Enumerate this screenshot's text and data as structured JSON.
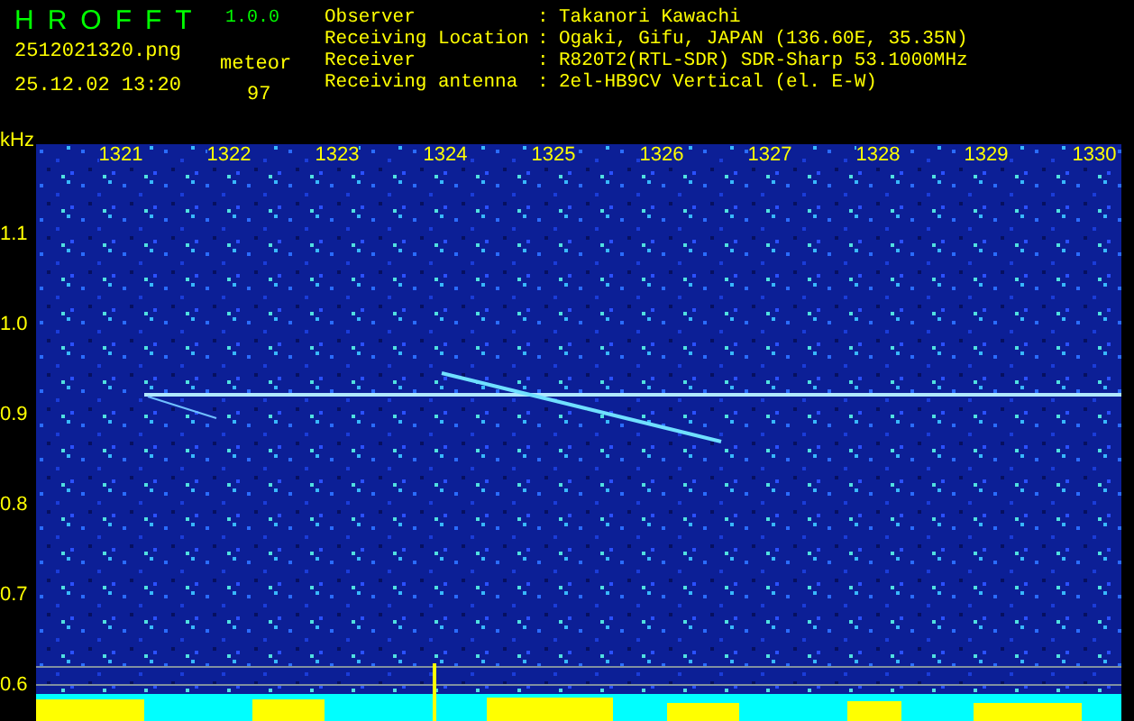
{
  "app": {
    "title": "HROFFT",
    "version": "1.0.0"
  },
  "file": {
    "name": "2512021320.png",
    "datetime": "25.12.02 13:20",
    "count_label": "meteor",
    "count": "97"
  },
  "info": [
    {
      "label": "Observer",
      "separator": ":",
      "value": "Takanori Kawachi"
    },
    {
      "label": "Receiving Location",
      "separator": ":",
      "value": "Ogaki, Gifu, JAPAN (136.60E, 35.35N)"
    },
    {
      "label": "Receiver",
      "separator": ":",
      "value": "R820T2(RTL-SDR) SDR-Sharp 53.1000MHz"
    },
    {
      "label": "Receiving antenna",
      "separator": ":",
      "value": "2el-HB9CV Vertical (el. E-W)"
    }
  ],
  "spectrogram": {
    "y_unit": "kHz",
    "y_labels": [
      "1.1",
      "1.0",
      "0.9",
      "0.8",
      "0.7",
      "0.6"
    ],
    "x_labels": [
      "1321",
      "1322",
      "1323",
      "1324",
      "1325",
      "1326",
      "1327",
      "1328",
      "1329",
      "1330"
    ]
  }
}
